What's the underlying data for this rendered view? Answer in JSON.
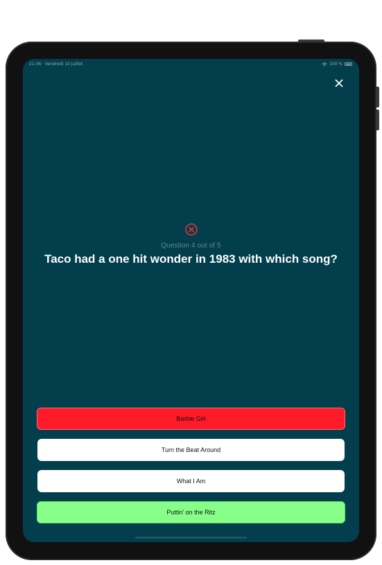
{
  "status_bar": {
    "time_date": "21:36 · Vendredi 10 juillet",
    "battery": "100 %"
  },
  "icons": {
    "close": "close-icon",
    "result": "wrong-answer-icon",
    "wifi": "wifi-icon",
    "battery": "battery-icon"
  },
  "quiz": {
    "progress": "Question 4 out of 5",
    "question": "Taco had a one hit wonder in 1983 with which song?",
    "answers": [
      {
        "label": "Barbie Girl",
        "state": "wrong"
      },
      {
        "label": "Turn the Beat Around",
        "state": "neutral"
      },
      {
        "label": "What I Am",
        "state": "neutral"
      },
      {
        "label": "Puttin' on the Ritz",
        "state": "correct"
      }
    ]
  },
  "colors": {
    "background": "#023e4c",
    "wrong": "#ff1a2a",
    "correct": "#88ff88",
    "neutral": "#ffffff",
    "progress_text": "#5f8c96",
    "wrong_icon": "#ff2a3a"
  }
}
